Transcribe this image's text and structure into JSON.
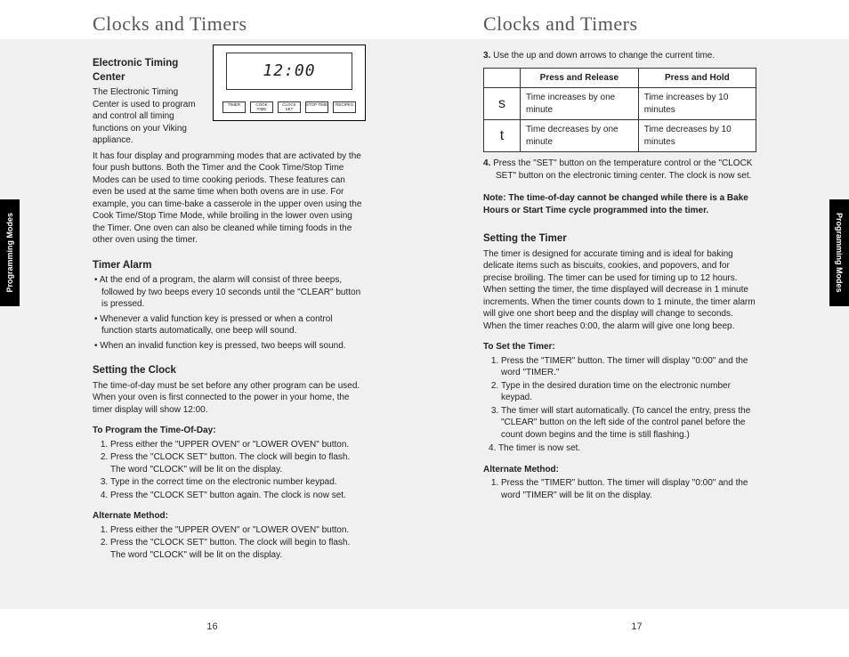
{
  "tabs": {
    "label": "Programming Modes"
  },
  "leftPage": {
    "title": "Clocks and Timers",
    "pageNum": "16",
    "sec1": {
      "heading": "Electronic Timing Center",
      "introA": "The Electronic Timing Center is used to program and control all timing functions on your Viking appliance.",
      "fig": {
        "time": "12:00",
        "b1": "TIMER",
        "b2": "COOK TIME",
        "b3": "CLOCK SET",
        "b4": "STOP TIME",
        "b5": "RECIPES"
      },
      "introB": "It has four display and programming modes that are activated by the four push buttons.  Both the Timer and the Cook Time/Stop Time Modes can be used to time cooking periods.  These features can even be used at the same time when both ovens are in use.  For example, you can time-bake a casserole in the upper oven using the Cook Time/Stop Time Mode, while broiling in the lower oven using the Timer.  One oven can also be cleaned while timing foods in the other oven using the timer."
    },
    "sec2": {
      "heading": "Timer Alarm",
      "b1": "At the end of a program, the alarm will consist of three beeps, followed by two beeps every 10 seconds until the \"CLEAR\" button is pressed.",
      "b2": "Whenever a valid function key is pressed or when a control function starts automatically, one beep will sound.",
      "b3": "When an invalid function key is pressed, two beeps will sound."
    },
    "sec3": {
      "heading": "Setting the Clock",
      "intro": "The time-of-day must be set before any other program can be used.  When your oven is first connected to the power in your home, the timer display will show 12:00.",
      "prog": "To Program the Time-Of-Day:",
      "p1": "Press either the \"UPPER OVEN\" or \"LOWER OVEN\" button.",
      "p2": "Press the \"CLOCK SET\" button. The clock will begin to flash. The word \"CLOCK\" will be lit on the display.",
      "p3": "Type in the correct time on the electronic number keypad.",
      "p4": "Press the \"CLOCK SET\" button again.  The clock is now set.",
      "alt": "Alternate Method:",
      "a1": "Press either the \"UPPER OVEN\" or \"LOWER OVEN\" button.",
      "a2": "Press the \"CLOCK SET\" button. The clock will begin to flash. The word \"CLOCK\" will be lit on the display."
    }
  },
  "rightPage": {
    "title": "Clocks and Timers",
    "pageNum": "17",
    "step3lead": "3.",
    "step3": " Use the up and down arrows to change the current time.",
    "table": {
      "h0": "",
      "h1": "Press and Release",
      "h2": "Press and Hold",
      "r1c0": "s",
      "r1c1": "Time increases by one minute",
      "r1c2": "Time increases by 10 minutes",
      "r2c0": "t",
      "r2c1": "Time decreases by one minute",
      "r2c2": "Time decreases by 10 minutes"
    },
    "step4lead": "4.",
    "step4": "  Press the \"SET\" button on the temperature control or the \"CLOCK SET\" button on the electronic timing center.  The clock is now set.",
    "note": "Note:  The time-of-day cannot be changed while there is a Bake Hours or Start Time cycle programmed into the timer.",
    "sec4": {
      "heading": "Setting the Timer",
      "intro": "The timer is designed for accurate timing and is ideal for baking delicate items such as biscuits, cookies, and popovers, and for precise broiling. The timer can be used for timing up to 12 hours. When setting the timer, the time displayed will decrease in 1 minute increments. When the timer counts down to 1 minute, the timer alarm will give one short beep and the display will change to seconds. When the timer reaches 0:00, the alarm will give one long beep.",
      "set": "To Set the Timer:",
      "s1": "Press the \"TIMER\" button. The timer will display \"0:00\" and the word \"TIMER.\"",
      "s2": "Type in the desired duration time on the electronic number keypad.",
      "s3": "The timer will start automatically. (To cancel the entry, press the \"CLEAR\" button on the left side of the control panel before the count down begins and the time is still flashing.)",
      "s4prefix": "4",
      "s4": ".  The timer is now set.",
      "alt": "Alternate Method:",
      "a1": "Press the \"TIMER\" button.  The timer will display \"0:00\" and the word \"TIMER\" will be lit on the display."
    }
  }
}
